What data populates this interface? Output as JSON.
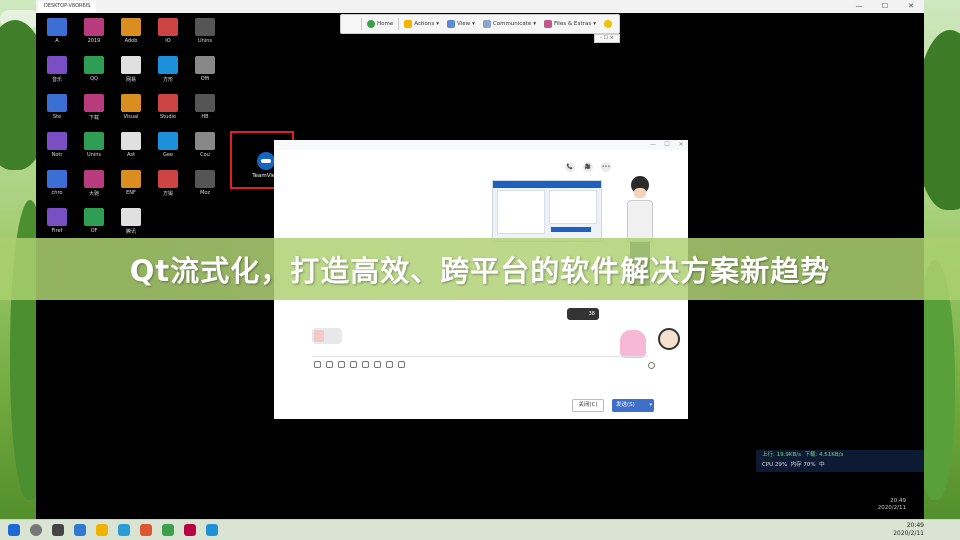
{
  "remote": {
    "tab_title": "DESKTOP-V8OR6IS",
    "win_min": "—",
    "win_max": "☐",
    "win_close": "✕"
  },
  "tv_toolbar": {
    "close": "✕",
    "home": "Home",
    "actions": "Actions",
    "view": "View",
    "communicate": "Communicate",
    "files": "Files & Extras",
    "sub_controls": "- ☐ ×"
  },
  "desktop_icons": [
    {
      "label": "A"
    },
    {
      "label": "2019"
    },
    {
      "label": "Adob"
    },
    {
      "label": "IO"
    },
    {
      "label": "Unins"
    },
    {
      "label": "音乐"
    },
    {
      "label": "QQ"
    },
    {
      "label": "网易"
    },
    {
      "label": "方形"
    },
    {
      "label": "Offi"
    },
    {
      "label": "Ste"
    },
    {
      "label": "下载"
    },
    {
      "label": "Visual"
    },
    {
      "label": "Studio"
    },
    {
      "label": "HB"
    },
    {
      "label": "Notr"
    },
    {
      "label": "Unins"
    },
    {
      "label": "Ast"
    },
    {
      "label": "Geo"
    },
    {
      "label": "Cou"
    },
    {
      "label": "chro"
    },
    {
      "label": "大驰"
    },
    {
      "label": "ENF"
    },
    {
      "label": "方锻"
    },
    {
      "label": "Moz"
    },
    {
      "label": "Firef"
    },
    {
      "label": "OF"
    },
    {
      "label": "腾讯"
    }
  ],
  "tv_desktop_icon": {
    "label": "TeamView"
  },
  "chat": {
    "head_min": "—",
    "head_max": "☐",
    "head_close": "✕",
    "call": "📞",
    "video": "🎥",
    "more": "•••",
    "dark_bubble": "38",
    "btn_close": "关闭(C)",
    "btn_send": "发送(S)",
    "btn_send_dd": "▾"
  },
  "tray": {
    "line1_up": "上行: 19.9KB/s",
    "line1_down": "下载: 4.51KB/s",
    "line2_cpu": "CPU 29%",
    "line2_mem": "内存 70%",
    "line2_ime": "中"
  },
  "remote_clock": {
    "time": "20:49",
    "date": "2020/2/11"
  },
  "headline": "Qt流式化，打造高效、跨平台的软件解决方案新趋势",
  "taskbar_clock": {
    "time": "20:49",
    "date": "2020/2/11"
  }
}
